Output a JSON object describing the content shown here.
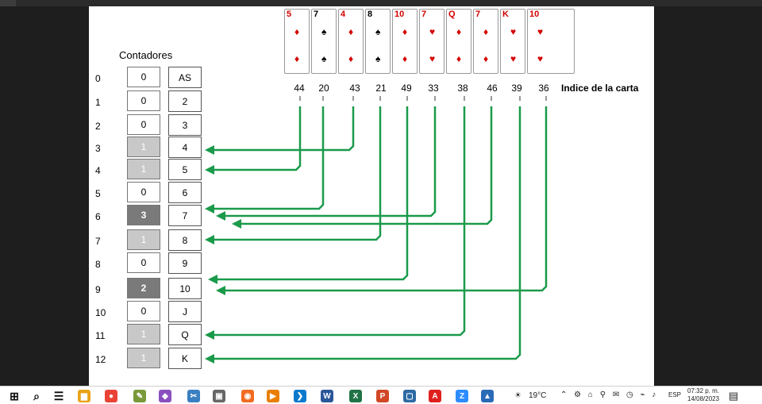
{
  "counters_title": "Contadores",
  "card_index_title": "Indice de la carta",
  "rows": [
    {
      "index": "0",
      "count": "0",
      "rank": "AS",
      "shade": "none"
    },
    {
      "index": "1",
      "count": "0",
      "rank": "2",
      "shade": "none"
    },
    {
      "index": "2",
      "count": "0",
      "rank": "3",
      "shade": "none"
    },
    {
      "index": "3",
      "count": "1",
      "rank": "4",
      "shade": "light"
    },
    {
      "index": "4",
      "count": "1",
      "rank": "5",
      "shade": "light"
    },
    {
      "index": "5",
      "count": "0",
      "rank": "6",
      "shade": "none"
    },
    {
      "index": "6",
      "count": "3",
      "rank": "7",
      "shade": "dark"
    },
    {
      "index": "7",
      "count": "1",
      "rank": "8",
      "shade": "light"
    },
    {
      "index": "8",
      "count": "0",
      "rank": "9",
      "shade": "none"
    },
    {
      "index": "9",
      "count": "2",
      "rank": "10",
      "shade": "dark"
    },
    {
      "index": "10",
      "count": "0",
      "rank": "J",
      "shade": "none"
    },
    {
      "index": "11",
      "count": "1",
      "rank": "Q",
      "shade": "light"
    },
    {
      "index": "12",
      "count": "1",
      "rank": "K",
      "shade": "light"
    }
  ],
  "cards": [
    {
      "rank": "5",
      "suit": "♦",
      "color": "red",
      "index": "44"
    },
    {
      "rank": "7",
      "suit": "♠",
      "color": "black",
      "index": "20"
    },
    {
      "rank": "4",
      "suit": "♦",
      "color": "red",
      "index": "43"
    },
    {
      "rank": "8",
      "suit": "♠",
      "color": "black",
      "index": "21"
    },
    {
      "rank": "10",
      "suit": "♦",
      "color": "red",
      "index": "49"
    },
    {
      "rank": "7",
      "suit": "♥",
      "color": "red",
      "index": "33"
    },
    {
      "rank": "Q",
      "suit": "♦",
      "color": "red",
      "index": "38"
    },
    {
      "rank": "7",
      "suit": "♦",
      "color": "red",
      "index": "46"
    },
    {
      "rank": "K",
      "suit": "♥",
      "color": "red",
      "index": "39"
    },
    {
      "rank": "10",
      "suit": "♥",
      "color": "red",
      "index": "36"
    }
  ],
  "arrow_color": "#1a9a4a",
  "taskbar": {
    "weather": "19°C",
    "lang": "ESP",
    "time": "07:32 p. m.",
    "date": "14/08/2023",
    "icons": [
      "windows-icon",
      "search-icon",
      "task-view-icon",
      "file-explorer-icon",
      "chrome-icon",
      "notepad-icon",
      "visual-studio-icon",
      "paint-icon",
      "snipping-tool-icon",
      "circle-app-icon",
      "media-icon",
      "vscode-icon",
      "word-icon",
      "excel-icon",
      "powerpoint-icon",
      "box-icon",
      "acrobat-icon",
      "zoom-icon",
      "photos-icon"
    ]
  }
}
